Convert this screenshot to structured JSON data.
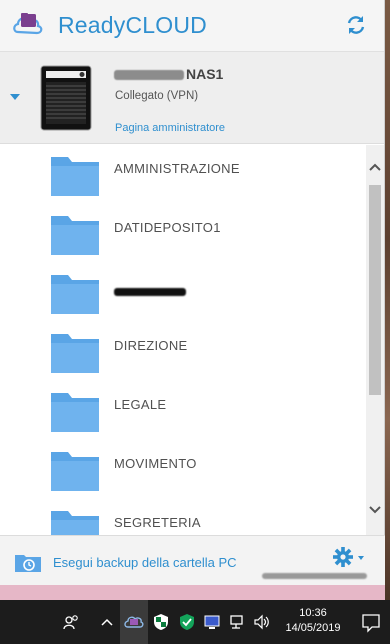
{
  "app": {
    "title": "ReadyCLOUD",
    "brand_color": "#2f8fcf",
    "folder_color": "#5aa5e6"
  },
  "device": {
    "name": "NAS1",
    "status": "Collegato (VPN)",
    "admin_link": "Pagina amministratore"
  },
  "folders": [
    {
      "label": "AMMINISTRAZIONE"
    },
    {
      "label": "DATIDEPOSITO1"
    },
    {
      "label": ""
    },
    {
      "label": "DIREZIONE"
    },
    {
      "label": "LEGALE"
    },
    {
      "label": "MOVIMENTO"
    },
    {
      "label": "SEGRETERIA"
    }
  ],
  "footer": {
    "backup_label": "Esegui backup della cartella PC"
  },
  "taskbar": {
    "time": "10:36",
    "date": "14/05/2019",
    "icons": [
      "people-icon",
      "chevron-up-icon",
      "readycloud-tray-icon",
      "security-shield-icon",
      "defender-check-icon",
      "display-icon",
      "network-icon",
      "volume-icon",
      "notification-icon"
    ]
  }
}
